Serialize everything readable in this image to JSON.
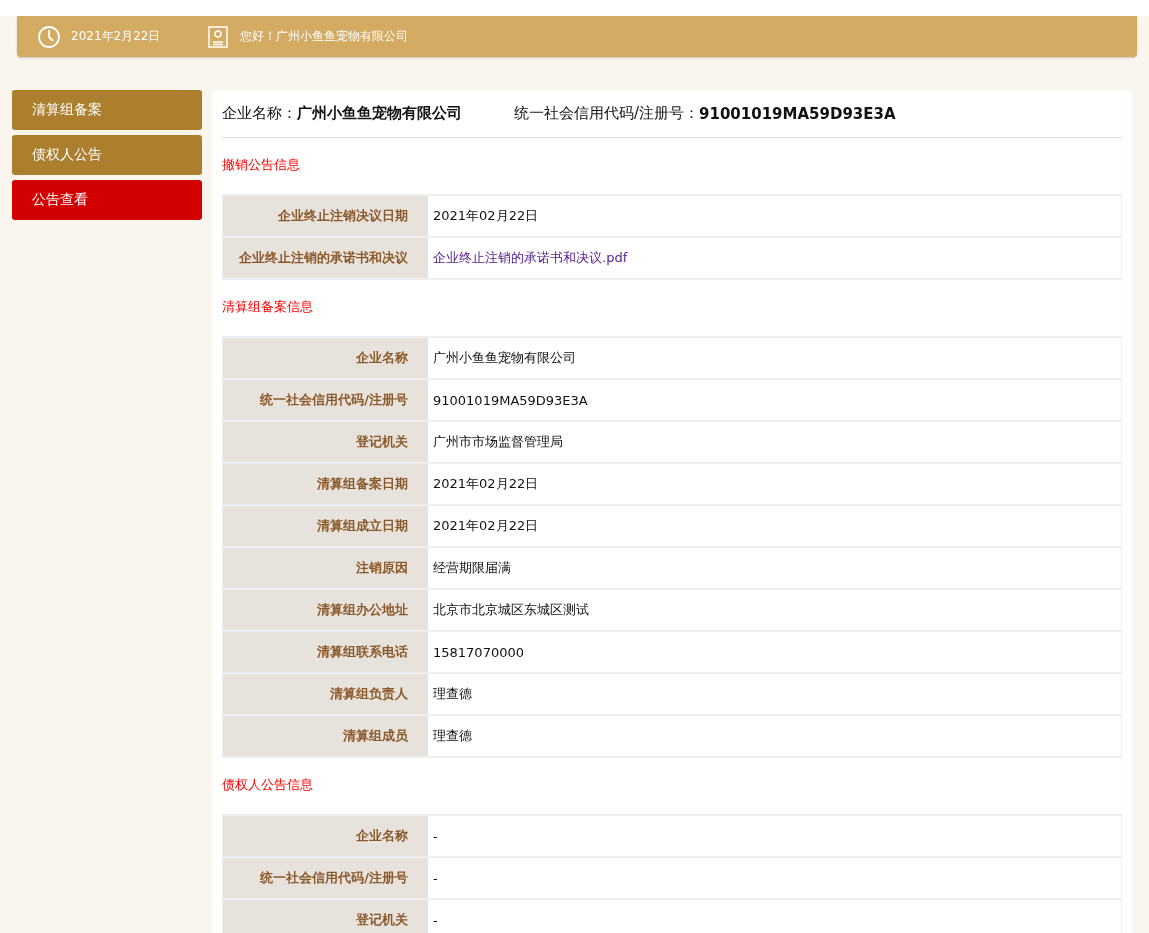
{
  "header": {
    "date": "2021年2月22日",
    "greeting": "您好！广州小鱼鱼宠物有限公司"
  },
  "sidebar": {
    "items": [
      {
        "label": "清算组备案",
        "selected": false
      },
      {
        "label": "债权人公告",
        "selected": false
      },
      {
        "label": "公告查看",
        "selected": true
      }
    ]
  },
  "summary": {
    "name_label": "企业名称：",
    "name": "广州小鱼鱼宠物有限公司",
    "code_label": "统一社会信用代码/注册号：",
    "code": "91001019MA59D93E3A"
  },
  "sections": [
    {
      "title": "撤销公告信息",
      "rows": [
        {
          "label": "企业终止注销决议日期",
          "value": "2021年02月22日",
          "kind": "text"
        },
        {
          "label": "企业终止注销的承诺书和决议",
          "value": "企业终止注销的承诺书和决议.pdf",
          "kind": "link"
        }
      ]
    },
    {
      "title": "清算组备案信息",
      "rows": [
        {
          "label": "企业名称",
          "value": "广州小鱼鱼宠物有限公司",
          "kind": "text"
        },
        {
          "label": "统一社会信用代码/注册号",
          "value": "91001019MA59D93E3A",
          "kind": "text"
        },
        {
          "label": "登记机关",
          "value": "广州市市场监督管理局",
          "kind": "text"
        },
        {
          "label": "清算组备案日期",
          "value": "2021年02月22日",
          "kind": "text"
        },
        {
          "label": "清算组成立日期",
          "value": "2021年02月22日",
          "kind": "text"
        },
        {
          "label": "注销原因",
          "value": "经营期限届满",
          "kind": "text"
        },
        {
          "label": "清算组办公地址",
          "value": "北京市北京城区东城区测试",
          "kind": "text"
        },
        {
          "label": "清算组联系电话",
          "value": "15817070000",
          "kind": "text"
        },
        {
          "label": "清算组负责人",
          "value": "理查德",
          "kind": "text"
        },
        {
          "label": "清算组成员",
          "value": "理查德",
          "kind": "text"
        }
      ]
    },
    {
      "title": "债权人公告信息",
      "rows": [
        {
          "label": "企业名称",
          "value": "-",
          "kind": "text"
        },
        {
          "label": "统一社会信用代码/注册号",
          "value": "-",
          "kind": "text"
        },
        {
          "label": "登记机关",
          "value": "-",
          "kind": "text"
        }
      ]
    }
  ]
}
